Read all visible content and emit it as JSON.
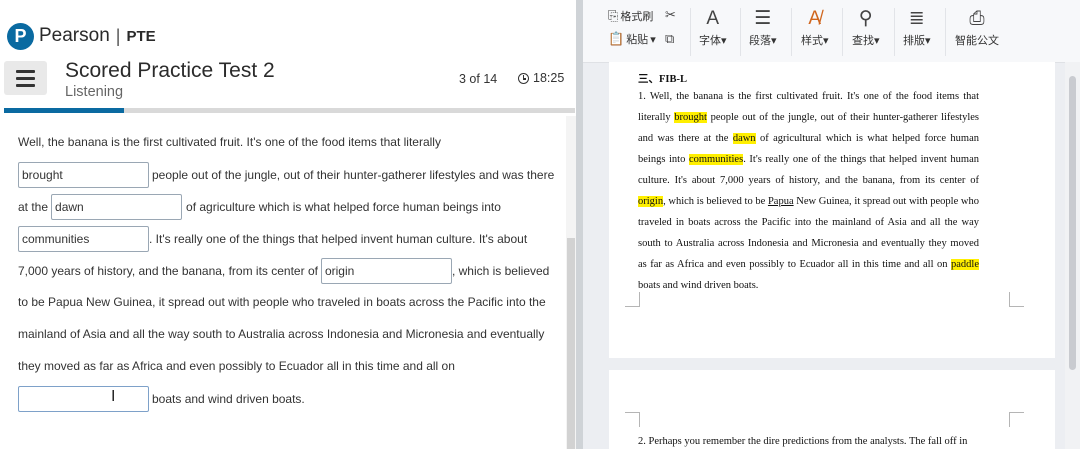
{
  "left": {
    "brand": {
      "logo_letter": "P",
      "name": "Pearson",
      "sep": "|",
      "product": "PTE"
    },
    "header": {
      "title": "Scored Practice Test 2",
      "subtitle": "Listening",
      "count": "3 of 14",
      "timer": "18:25"
    },
    "progress": {
      "fraction": 0.21,
      "color": "#0a6aa1"
    },
    "passage": {
      "l1": "Well, the banana is the first cultivated fruit. It's one of the food items that literally",
      "b1": "brought",
      "l2": "people out of the jungle, out of their hunter-gatherer lifestyles and was there",
      "l3a": "at the",
      "b2": "dawn",
      "l3b": "of agriculture which is what helped force human beings into",
      "b3": "communities",
      "l4": ". It's really one of the things that helped invent human culture. It's about",
      "l5a": "7,000 years of history, and the banana, from its center of",
      "b4": "origin",
      "l5b": ", which is believed",
      "l6": "to be Papua New Guinea, it spread out with people who traveled in boats across the Pacific into the",
      "l7": "mainland of Asia and all the way south to Australia across Indonesia and Micronesia and eventually",
      "l8": "they moved as far as Africa and even possibly to Ecuador all in this time and all on",
      "b5": "",
      "l9": "boats and wind driven boats."
    }
  },
  "right": {
    "ribbon": {
      "format_painter": "格式刷",
      "paste": "粘贴",
      "font": "字体",
      "paragraph": "段落",
      "style": "样式",
      "find": "查找",
      "layout": "排版",
      "smart": "智能公文"
    },
    "doc": {
      "heading": "三、FIB-L",
      "p1_a": "1.  Well, the banana is the first cultivated fruit. It's one of the food items that literally ",
      "h1": "brought",
      "p1_b": " people out of the jungle, out of their hunter-gatherer lifestyles and was there at the ",
      "h2": "dawn",
      "p1_c": " of agricultural which is what helped force human beings into ",
      "h3": "communities",
      "p1_d": ". It's really one of the things that helped invent human culture. It's about 7,000 years of history, and the banana, from its center of ",
      "h4": "origin",
      "p1_e": ", which is believed to be ",
      "u1": "Papua",
      "p1_f": " New Guinea, it spread out with people who traveled in boats across the Pacific into the mainland of Asia and all the way south to Australia across Indonesia and Micronesia and eventually they moved as far as Africa and even possibly to Ecuador all in this time and all on ",
      "h5": "paddle",
      "p1_g": " boats and wind driven boats.",
      "p2": "2.  Perhaps you remember the dire predictions from the analysts. The fall off in"
    },
    "highlight_color": "#ffef00"
  }
}
